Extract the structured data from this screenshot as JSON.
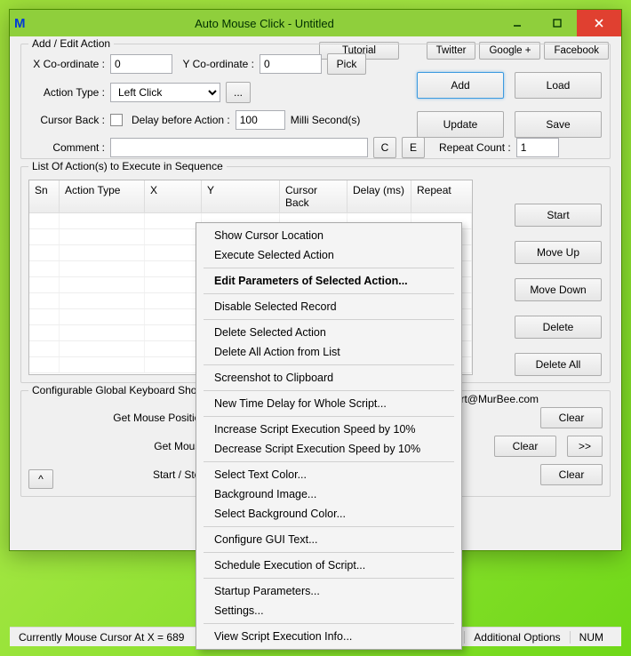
{
  "window": {
    "app_icon_letter": "M",
    "title": "Auto Mouse Click - Untitled"
  },
  "links": {
    "tutorial": "Tutorial",
    "twitter": "Twitter",
    "google": "Google +",
    "facebook": "Facebook"
  },
  "add_edit": {
    "legend": "Add / Edit Action",
    "x_label": "X Co-ordinate :",
    "x_value": "0",
    "y_label": "Y Co-ordinate :",
    "y_value": "0",
    "pick": "Pick",
    "action_type_label": "Action Type :",
    "action_type_value": "Left Click",
    "dots": "...",
    "cursor_back_label": "Cursor Back :",
    "delay_label": "Delay before Action :",
    "delay_value": "100",
    "delay_units": "Milli Second(s)",
    "comment_label": "Comment :",
    "comment_value": "",
    "c_btn": "C",
    "e_btn": "E",
    "repeat_label": "Repeat Count :",
    "repeat_value": "1"
  },
  "side": {
    "add": "Add",
    "load": "Load",
    "update": "Update",
    "save": "Save"
  },
  "list": {
    "legend": "List Of Action(s) to Execute in Sequence",
    "headers": {
      "sn": "Sn",
      "action": "Action Type",
      "x": "X",
      "y": "Y",
      "cursor": "Cursor Back",
      "delay": "Delay (ms)",
      "repeat": "Repeat"
    }
  },
  "side2": {
    "start": "Start",
    "moveup": "Move Up",
    "movedown": "Move Down",
    "delete": "Delete",
    "deleteall": "Delete All"
  },
  "kb": {
    "legend": "Configurable Global Keyboard Shortcuts",
    "support": "Support@MurBee.com",
    "row1": "Get Mouse Position",
    "row2": "Get Mouse",
    "row3": "Start / Stop",
    "clear": "Clear",
    "more": ">>",
    "caret": "^"
  },
  "status": {
    "text": "Currently Mouse Cursor At X = 689",
    "opts": "Additional Options",
    "num": "NUM"
  },
  "context_menu": [
    {
      "type": "item",
      "label": "Show Cursor Location"
    },
    {
      "type": "item",
      "label": "Execute Selected Action"
    },
    {
      "type": "sep"
    },
    {
      "type": "item",
      "label": "Edit Parameters of Selected Action...",
      "bold": true
    },
    {
      "type": "sep"
    },
    {
      "type": "item",
      "label": "Disable Selected Record"
    },
    {
      "type": "sep"
    },
    {
      "type": "item",
      "label": "Delete Selected Action"
    },
    {
      "type": "item",
      "label": "Delete All Action from List"
    },
    {
      "type": "sep"
    },
    {
      "type": "item",
      "label": "Screenshot to Clipboard"
    },
    {
      "type": "sep"
    },
    {
      "type": "item",
      "label": "New Time Delay for Whole Script..."
    },
    {
      "type": "sep"
    },
    {
      "type": "item",
      "label": "Increase Script Execution Speed by 10%"
    },
    {
      "type": "item",
      "label": "Decrease Script Execution Speed by 10%"
    },
    {
      "type": "sep"
    },
    {
      "type": "item",
      "label": "Select Text Color..."
    },
    {
      "type": "item",
      "label": "Background Image..."
    },
    {
      "type": "item",
      "label": "Select Background Color..."
    },
    {
      "type": "sep"
    },
    {
      "type": "item",
      "label": "Configure GUI Text..."
    },
    {
      "type": "sep"
    },
    {
      "type": "item",
      "label": "Schedule Execution of Script..."
    },
    {
      "type": "sep"
    },
    {
      "type": "item",
      "label": "Startup Parameters..."
    },
    {
      "type": "item",
      "label": "Settings..."
    },
    {
      "type": "sep"
    },
    {
      "type": "item",
      "label": "View Script Execution Info..."
    }
  ]
}
